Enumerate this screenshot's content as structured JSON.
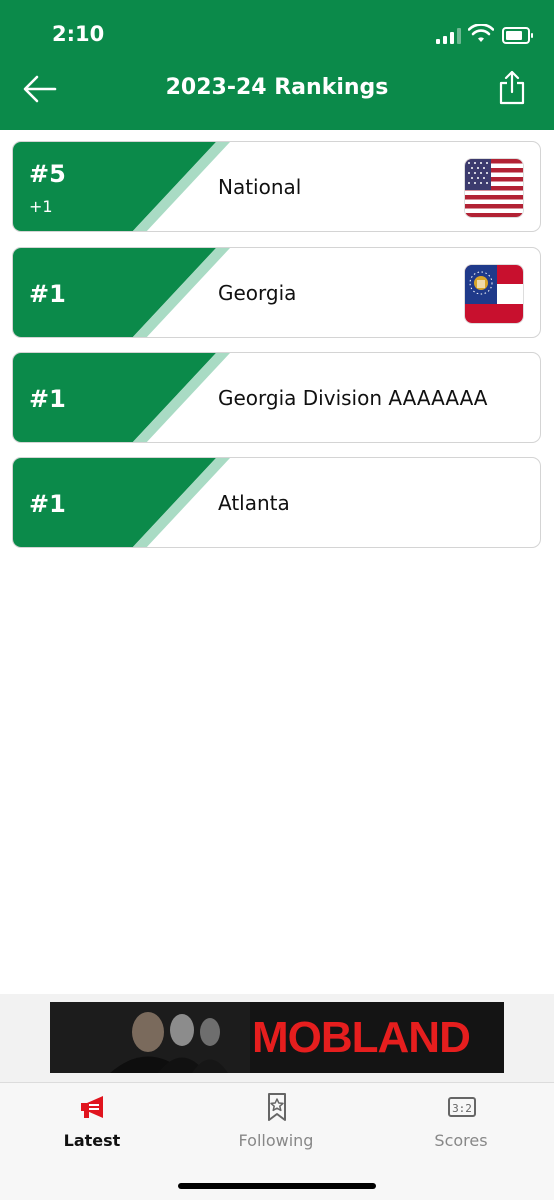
{
  "status_bar": {
    "time": "2:10"
  },
  "header": {
    "title": "2023-24 Rankings"
  },
  "rankings": [
    {
      "rank": "#5",
      "change": "+1",
      "label": "National",
      "flag": "us-flag-icon"
    },
    {
      "rank": "#1",
      "change": "",
      "label": "Georgia",
      "flag": "georgia-flag-icon"
    },
    {
      "rank": "#1",
      "change": "",
      "label": "Georgia Division AAAAAAA",
      "flag": ""
    },
    {
      "rank": "#1",
      "change": "",
      "label": "Atlanta",
      "flag": ""
    }
  ],
  "ad": {
    "text": "MOBLAND"
  },
  "tabs": [
    {
      "label": "Latest",
      "icon": "megaphone-icon",
      "active": true
    },
    {
      "label": "Following",
      "icon": "bookmark-star-icon",
      "active": false
    },
    {
      "label": "Scores",
      "icon": "scoreboard-icon",
      "active": false
    }
  ],
  "colors": {
    "brand_green": "#0b8a4a",
    "stripe_green": "#a9dbc4",
    "active_tab_icon": "#e0141e"
  }
}
